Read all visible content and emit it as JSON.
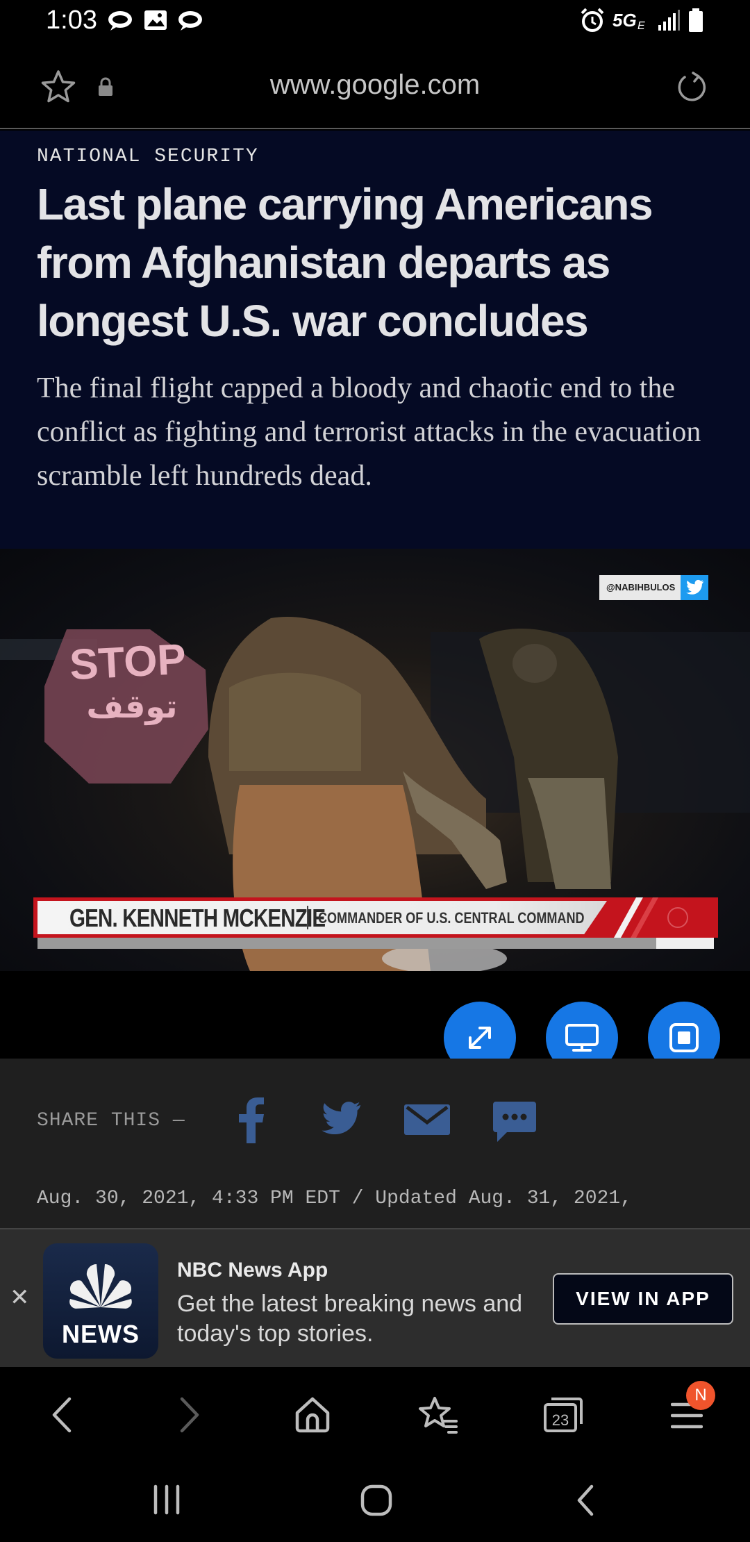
{
  "status_bar": {
    "time": "1:03",
    "network": "5G"
  },
  "url_bar": {
    "url": "www.google.com",
    "icons": [
      "star-icon",
      "lock-icon",
      "refresh-icon"
    ]
  },
  "article": {
    "section": "NATIONAL SECURITY",
    "headline": "Last plane carrying Americans from Afghanistan departs as longest U.S. war concludes",
    "dek": "The final flight capped a bloody and chaotic end to the conflict as fighting and terrorist attacks in the evacuation scramble left hundreds dead."
  },
  "video": {
    "twitter_handle": "@NABIHBULOS",
    "sign_text": "STOP",
    "sign_text_arabic": "توقف",
    "lower_third_name": "GEN. KENNETH MCKENZIE",
    "lower_third_role": "COMMANDER OF U.S. CENTRAL COMMAND",
    "progress": 0.915,
    "controls": [
      "fullscreen-icon",
      "cast-icon",
      "picture-in-picture-icon"
    ]
  },
  "share": {
    "label": "SHARE THIS —",
    "icons": [
      "facebook-icon",
      "twitter-icon",
      "email-icon",
      "sms-icon"
    ],
    "timestamp": "Aug. 30, 2021, 4:33 PM EDT / Updated Aug. 31, 2021,"
  },
  "app_banner": {
    "title": "NBC News App",
    "description": "Get the latest breaking news and today's top stories.",
    "logo_text": "NEWS",
    "button_label": "VIEW IN APP",
    "close_glyph": "✕"
  },
  "browser_toolbar": {
    "tabs_count": "23",
    "menu_badge": "N"
  }
}
